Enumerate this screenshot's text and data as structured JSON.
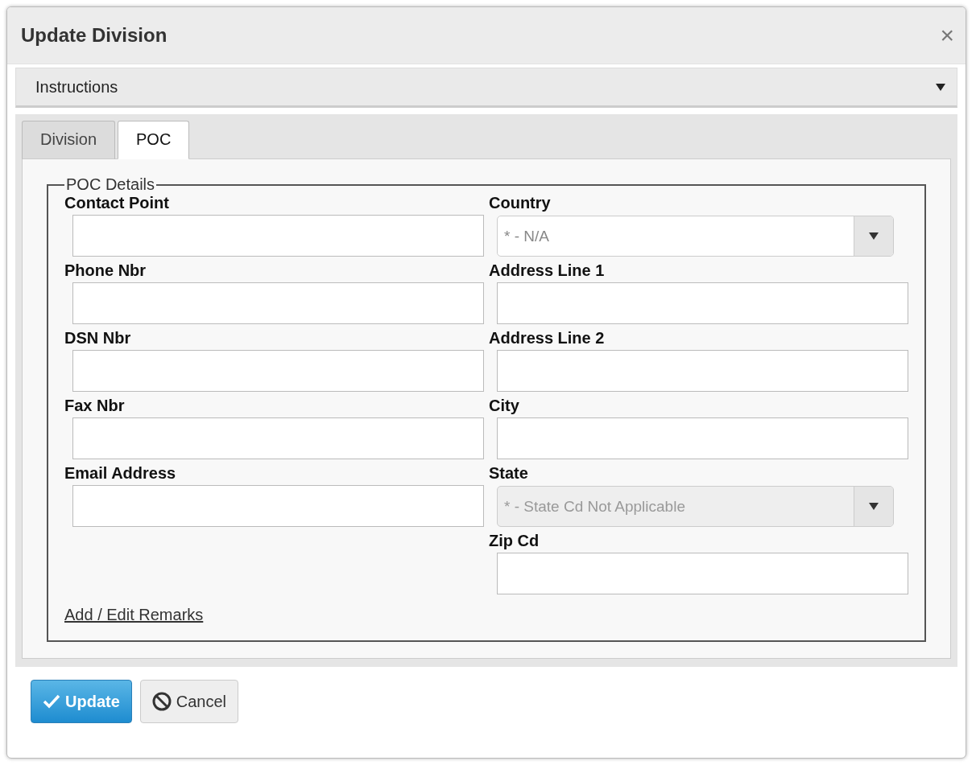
{
  "dialog": {
    "title": "Update Division",
    "close": "×"
  },
  "instructions": {
    "label": "Instructions",
    "expanded": false
  },
  "tabs": [
    {
      "label": "Division",
      "selected": false
    },
    {
      "label": "POC",
      "selected": true
    }
  ],
  "fieldset": {
    "legend": "POC Details",
    "left": [
      {
        "kind": "text",
        "label": "Contact Point",
        "disabled": false
      },
      {
        "kind": "text",
        "label": "Phone Nbr",
        "disabled": false
      },
      {
        "kind": "text",
        "label": "DSN Nbr",
        "disabled": false
      },
      {
        "kind": "text",
        "label": "Fax Nbr",
        "disabled": false
      },
      {
        "kind": "text",
        "label": "Email Address",
        "disabled": false
      }
    ],
    "right": [
      {
        "kind": "select",
        "label": "Country",
        "value": "* - N/A",
        "disabled": false
      },
      {
        "kind": "text",
        "label": "Address Line 1",
        "disabled": false
      },
      {
        "kind": "text",
        "label": "Address Line 2",
        "disabled": false
      },
      {
        "kind": "text",
        "label": "City",
        "disabled": false
      },
      {
        "kind": "select",
        "label": "State",
        "value": "* - State Cd Not Applicable",
        "disabled": true
      },
      {
        "kind": "text",
        "label": "Zip Cd",
        "disabled": false
      }
    ],
    "link": "Add / Edit Remarks"
  },
  "buttons": [
    {
      "kind": "primary",
      "label": "Update"
    },
    {
      "kind": "cancel",
      "label": "Cancel"
    }
  ]
}
